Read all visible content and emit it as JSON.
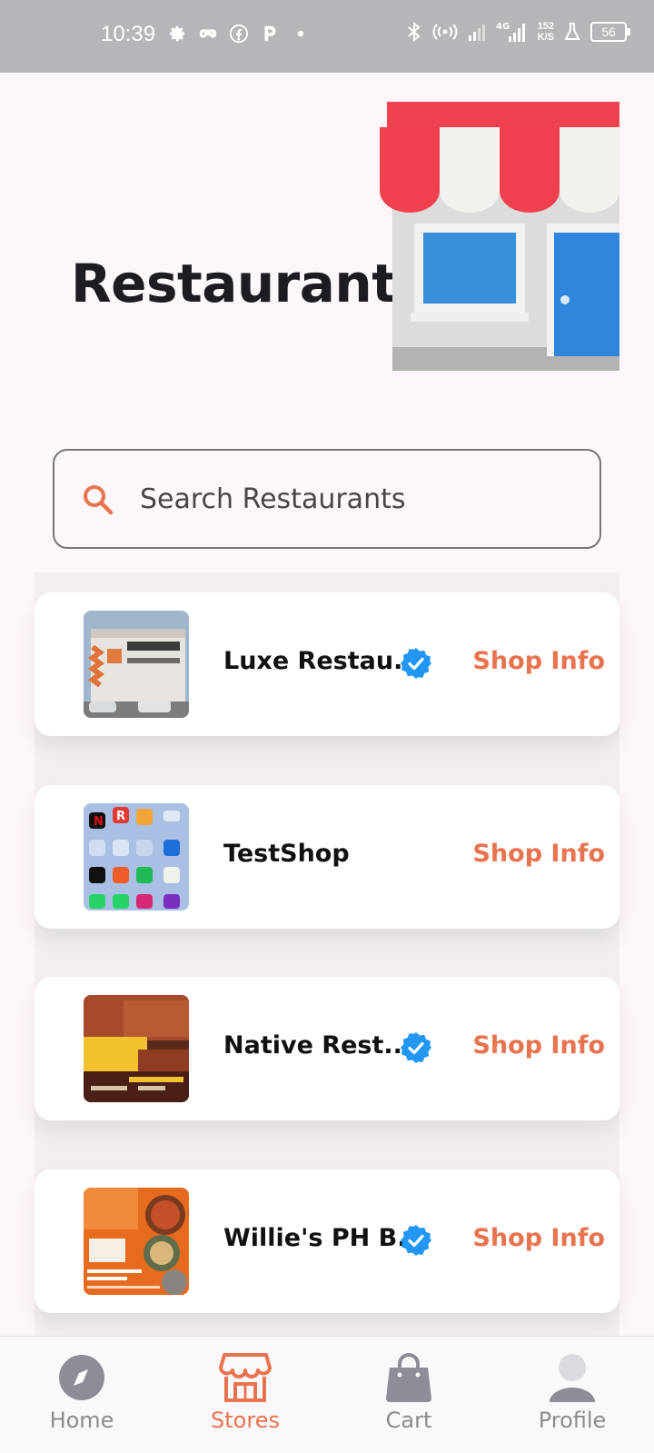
{
  "status_bar": {
    "time": "10:39",
    "left_icons": [
      "settings-icon",
      "gamepad-icon",
      "facebook-icon",
      "p-app-icon",
      "dot-icon"
    ],
    "right_icons": [
      "bluetooth-icon",
      "hotspot-icon",
      "signal-icon",
      "4g-signal-icon"
    ],
    "network_speed_value": "152",
    "network_speed_unit": "K/S",
    "battery": "56"
  },
  "header": {
    "title": "Restaurants",
    "illustration": "storefront-illustration"
  },
  "search": {
    "placeholder": "Search Restaurants",
    "value": ""
  },
  "restaurants": [
    {
      "name": "Luxe Restau...",
      "verified": true,
      "action": "Shop Info",
      "thumbnail": "building-photo"
    },
    {
      "name": "TestShop",
      "verified": false,
      "action": "Shop Info",
      "thumbnail": "phone-homescreen-screenshot"
    },
    {
      "name": "Native Rest...",
      "verified": true,
      "action": "Shop Info",
      "thumbnail": "grand-opening-flyer"
    },
    {
      "name": "Willie's PH B...",
      "verified": true,
      "action": "Shop Info",
      "thumbnail": "willies-food-flyer"
    }
  ],
  "bottom_nav": {
    "items": [
      {
        "label": "Home",
        "icon": "compass-icon",
        "active": false
      },
      {
        "label": "Stores",
        "icon": "store-icon",
        "active": true
      },
      {
        "label": "Cart",
        "icon": "shopping-bag-icon",
        "active": false
      },
      {
        "label": "Profile",
        "icon": "person-icon",
        "active": false
      }
    ]
  },
  "colors": {
    "accent": "#e8734f",
    "verified_badge": "#2196f3",
    "status_bar": "#b8b5ba",
    "background": "#fdf6fb"
  }
}
